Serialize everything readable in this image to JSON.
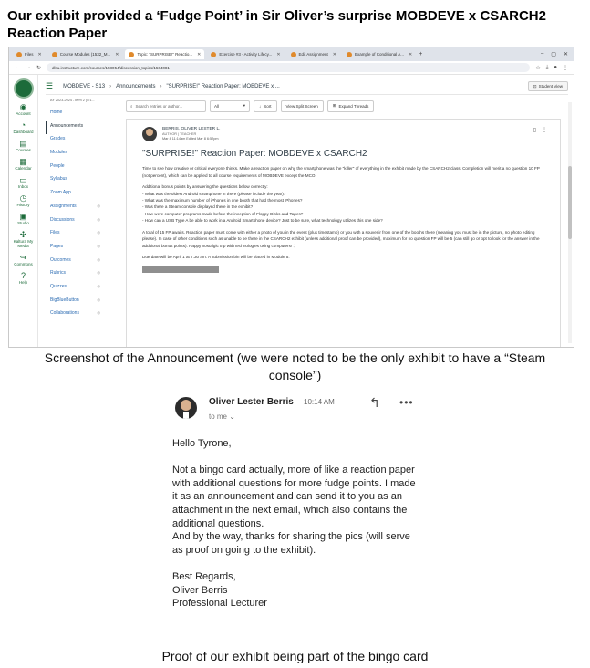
{
  "document": {
    "title": "Our exhibit provided a ‘Fudge Point’ in Sir Oliver’s surprise MOBDEVE x CSARCH2 Reaction Paper",
    "caption_announcement": "Screenshot of the Announcement (we were noted to be the only exhibit to have a “Steam console”)",
    "caption_email": "Proof of our exhibit being part of the bingo card"
  },
  "browser": {
    "tabs": [
      {
        "label": "Files",
        "active": false
      },
      {
        "label": "Course Modules (1532_M...",
        "active": false
      },
      {
        "label": "Topic: \"SURPRISE!\" Reactio...",
        "active": true
      },
      {
        "label": "Exercise #3 - Activity Lifecy...",
        "active": false
      },
      {
        "label": "Edit Assignment",
        "active": false
      },
      {
        "label": "Example of Conditional A...",
        "active": false
      }
    ],
    "url": "dlsu.instructure.com/courses/158054/discussion_topics/1564081"
  },
  "global_nav": [
    {
      "icon": "user-icon",
      "glyph": "◉",
      "label": "Account"
    },
    {
      "icon": "dashboard-icon",
      "glyph": "◔",
      "label": "Dashboard"
    },
    {
      "icon": "courses-icon",
      "glyph": "▤",
      "label": "Courses"
    },
    {
      "icon": "calendar-icon",
      "glyph": "▦",
      "label": "Calendar"
    },
    {
      "icon": "inbox-icon",
      "glyph": "▭",
      "label": "Inbox"
    },
    {
      "icon": "history-icon",
      "glyph": "◷",
      "label": "History"
    },
    {
      "icon": "studio-icon",
      "glyph": "▣",
      "label": "Studio"
    },
    {
      "icon": "kaltura-icon",
      "glyph": "✣",
      "label": "Kaltura My Media"
    },
    {
      "icon": "commons-icon",
      "glyph": "↪",
      "label": "Commons"
    },
    {
      "icon": "help-icon",
      "glyph": "?",
      "label": "Help"
    }
  ],
  "breadcrumb": {
    "course": "MOBDEVE - S13",
    "section": "Announcements",
    "topic": "\"SURPRISE!\" Reaction Paper: MOBDEVE x ...",
    "student_view": "Student View"
  },
  "course_nav": {
    "term": "AY 2023-2024 -Term 2 (5/1...",
    "items": [
      "Home",
      "Announcements",
      "Grades",
      "Modules",
      "People",
      "Syllabus",
      "Zoom App",
      "Assignments",
      "Discussions",
      "Files",
      "Pages",
      "Outcomes",
      "Rubrics",
      "Quizzes",
      "BigBlueButton",
      "Collaborations"
    ]
  },
  "toolbar": {
    "search_placeholder": "Search entries or author...",
    "filter": "All",
    "sort": "Sort",
    "split_screen": "View Split Screen",
    "expand": "Expand Threads"
  },
  "post": {
    "author": "BERRIS, OLIVER LESTER L.",
    "role": "AUTHOR | TEACHER",
    "date": "Mar 8 11:14am Edited Mar 8 6:52pm",
    "title": "\"SURPRISE!\" Reaction Paper: MOBDEVE x CSARCH2",
    "p1": "Time to see how creative or critical everyone thinks. Make a reaction paper on why the smartphone was the \"killer\" of everything in the exhibit made by the CSARCH2 class. Completion will merit a no question 10 FP (not percent), which can be applied to all course requirements of MOBDEVE except the MCO.",
    "bonus_intro": "Additional bonus points by answering the questions below correctly:",
    "questions": [
      "- What was the oldest Android smartphone in there (please include the year)?",
      "- What was the maximum number of iPhones in one booth that had the most iPhones?",
      "- Was there a Steam console displayed there in the exhibit?",
      "- How were computer programs made before the inception of Floppy Disks and Tapes?",
      "- How can a USB Type A be able to work in a Android Smartphone device? Just to be sure, what technology utilizes this one side?"
    ],
    "p2": "A total of 15 FP awaits. Reaction paper must come with either a photo of you in the event (plus timestamp) or you with a souvenir from one of the booths there (meaning you must be in the picture, no photo editing please). In case of other conditions such as unable to be there in the CSARCH2 exhibit (unless additional proof can be provided), maximum for no question FP will be 5 (can still go or opt to look for the answer in the additional bonus points). Happy nostalgic trip with technologies using computers! :)",
    "due": "Due date will be April 1 at 7:30 am. A submission bin will be placed in Module 5."
  },
  "email": {
    "sender": "Oliver Lester Berris",
    "time": "10:14 AM",
    "to": "to me",
    "greeting": "Hello Tyrone,",
    "para1": "Not a bingo card actually, more of like a reaction paper with additional questions for more fudge points. I made it as an announcement and can send it to you as an attachment in the next email, which also contains the additional questions.",
    "para2": "And by the way, thanks for sharing the pics (will serve as proof on going to the exhibit).",
    "closing": "Best Regards,",
    "signature_name": "Oliver Berris",
    "signature_title": "Professional Lecturer"
  }
}
